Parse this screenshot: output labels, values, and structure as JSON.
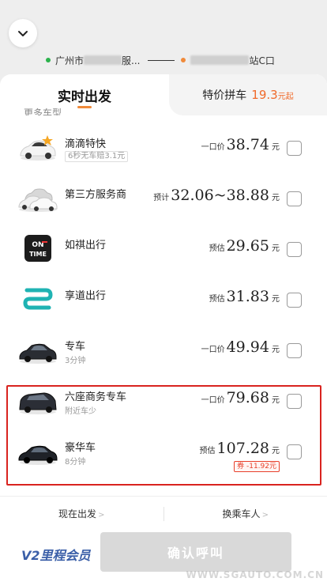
{
  "route": {
    "from_prefix": "广州市",
    "from_suffix": "服...",
    "to_prefix": "",
    "to_suffix": "站C口"
  },
  "tabs": {
    "active": "实时出发",
    "other_label": "特价拼车",
    "other_price": "19.3",
    "other_unit": "元起"
  },
  "section_title": "更多车型",
  "rows": [
    {
      "name": "滴滴特快",
      "sub": "6秒无车赔3.1元",
      "price_type": "一口价",
      "price": "38.74",
      "unit": "元",
      "icon": "car-white-icon"
    },
    {
      "name": "第三方服务商",
      "sub": "",
      "price_type": "预计",
      "price": "32.06~38.88",
      "unit": "元",
      "icon": "cars-group-icon"
    },
    {
      "name": "如祺出行",
      "sub": "",
      "price_type": "预估",
      "price": "29.65",
      "unit": "元",
      "icon": "ontime-logo-icon"
    },
    {
      "name": "享道出行",
      "sub": "",
      "price_type": "预估",
      "price": "31.83",
      "unit": "元",
      "icon": "xiangdao-logo-icon"
    },
    {
      "name": "专车",
      "sub": "3分钟",
      "price_type": "一口价",
      "price": "49.94",
      "unit": "元",
      "icon": "car-black-icon"
    },
    {
      "name": "六座商务专车",
      "sub": "附近车少",
      "price_type": "一口价",
      "price": "79.68",
      "unit": "元",
      "icon": "mpv-icon"
    },
    {
      "name": "豪华车",
      "sub": "8分钟",
      "price_type": "预估",
      "price": "107.28",
      "unit": "元",
      "coupon": "券 -11.92元",
      "icon": "luxury-car-icon"
    }
  ],
  "options": {
    "depart_now": "现在出发",
    "change_rider": "换乘车人"
  },
  "footer": {
    "member": "V2里程会员",
    "confirm": "确认呼叫"
  },
  "watermark": "WWW.SGAUTO.COM.CN",
  "colors": {
    "accent_orange": "#f08a3a",
    "price_red": "#f06a2a",
    "highlight_red": "#d9231f",
    "member_blue": "#3b5fa8"
  }
}
